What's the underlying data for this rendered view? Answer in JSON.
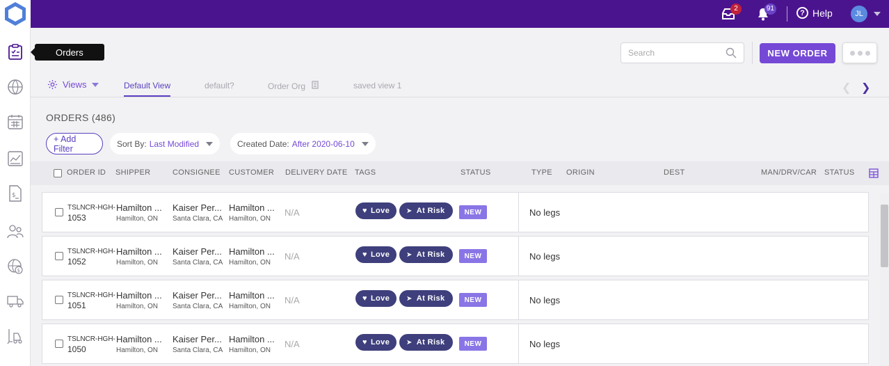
{
  "topbar": {
    "inbox_badge": "2",
    "notifications_badge": "91",
    "help_label": "Help",
    "avatar_initials": "JL"
  },
  "sidebar": {
    "tooltip": "Orders",
    "items": [
      "orders",
      "network",
      "calendar",
      "reports",
      "billing",
      "contacts",
      "global-settings",
      "trucks",
      "forklift"
    ]
  },
  "header": {
    "search_placeholder": "Search",
    "new_order_label": "NEW ORDER"
  },
  "tabs": {
    "views_label": "Views",
    "items": [
      {
        "label": "Default View",
        "active": true
      },
      {
        "label": "default?",
        "active": false
      },
      {
        "label": "Order Org",
        "active": false
      },
      {
        "label": "saved view 1",
        "active": false
      }
    ]
  },
  "orders": {
    "title": "ORDERS (486)",
    "add_filter_label": "+ Add Filter",
    "sort_label": "Sort By:",
    "sort_value": "Last Modified",
    "created_label": "Created Date:",
    "created_value": "After 2020-06-10"
  },
  "table": {
    "columns": [
      "ORDER ID",
      "SHIPPER",
      "CONSIGNEE",
      "CUSTOMER",
      "DELIVERY DATE",
      "TAGS",
      "STATUS",
      "TYPE",
      "ORIGIN",
      "DEST",
      "MAN/DRV/CAR",
      "STATUS"
    ],
    "rows": [
      {
        "id_prefix": "TSLNCR-HGH-",
        "id_num": "1053",
        "shipper": "Hamilton ...",
        "shipper_loc": "Hamilton, ON",
        "consignee": "Kaiser Per...",
        "consignee_loc": "Santa Clara, CA",
        "customer": "Hamilton ...",
        "customer_loc": "Hamilton, ON",
        "delivery": "N/A",
        "tag1": "Love",
        "tag2": "At Risk",
        "status": "NEW",
        "legs": "No legs"
      },
      {
        "id_prefix": "TSLNCR-HGH-",
        "id_num": "1052",
        "shipper": "Hamilton ...",
        "shipper_loc": "Hamilton, ON",
        "consignee": "Kaiser Per...",
        "consignee_loc": "Santa Clara, CA",
        "customer": "Hamilton ...",
        "customer_loc": "Hamilton, ON",
        "delivery": "N/A",
        "tag1": "Love",
        "tag2": "At Risk",
        "status": "NEW",
        "legs": "No legs"
      },
      {
        "id_prefix": "TSLNCR-HGH-",
        "id_num": "1051",
        "shipper": "Hamilton ...",
        "shipper_loc": "Hamilton, ON",
        "consignee": "Kaiser Per...",
        "consignee_loc": "Santa Clara, CA",
        "customer": "Hamilton ...",
        "customer_loc": "Hamilton, ON",
        "delivery": "N/A",
        "tag1": "Love",
        "tag2": "At Risk",
        "status": "NEW",
        "legs": "No legs"
      },
      {
        "id_prefix": "TSLNCR-HGH-",
        "id_num": "1050",
        "shipper": "Hamilton ...",
        "shipper_loc": "Hamilton, ON",
        "consignee": "Kaiser Per...",
        "consignee_loc": "Santa Clara, CA",
        "customer": "Hamilton ...",
        "customer_loc": "Hamilton, ON",
        "delivery": "N/A",
        "tag1": "Love",
        "tag2": "At Risk",
        "status": "NEW",
        "legs": "No legs"
      }
    ]
  },
  "colors": {
    "topbar": "#4b148f",
    "accent": "#7549d6",
    "tag": "#3e3f7c",
    "status_new": "#8a75e6"
  }
}
